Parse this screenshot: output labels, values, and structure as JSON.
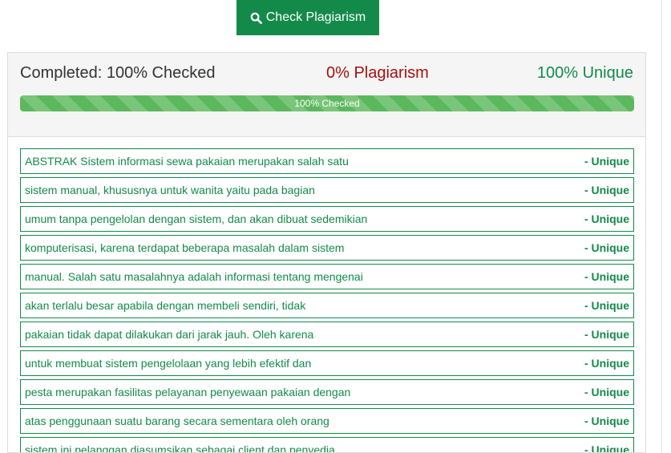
{
  "toolbar": {
    "check_label": "Check Plagiarism",
    "check_icon": "search-icon",
    "button_color": "#138a4a"
  },
  "summary": {
    "completed": "Completed: 100% Checked",
    "plagiarism": "0% Plagiarism",
    "unique": "100% Unique",
    "plagiarism_color": "#a80f0f",
    "unique_color": "#138a4a"
  },
  "progress": {
    "label": "100% Checked",
    "value": 100,
    "color": "#5cb85c"
  },
  "sentences": [
    {
      "text": "ABSTRAK Sistem informasi sewa pakaian merupakan salah satu",
      "status": "- Unique"
    },
    {
      "text": "sistem manual, khususnya untuk wanita yaitu pada bagian",
      "status": "- Unique"
    },
    {
      "text": "umum tanpa pengelolan dengan sistem, dan akan dibuat sedemikian",
      "status": "- Unique"
    },
    {
      "text": "komputerisasi, karena terdapat beberapa masalah dalam sistem",
      "status": "- Unique"
    },
    {
      "text": "manual. Salah satu masalahnya adalah informasi tentang mengenai",
      "status": "- Unique"
    },
    {
      "text": "akan terlalu besar apabila dengan membeli sendiri, tidak",
      "status": "- Unique"
    },
    {
      "text": "pakaian tidak dapat dilakukan dari jarak jauh. Oleh karena",
      "status": "- Unique"
    },
    {
      "text": "untuk membuat sistem pengelolaan yang lebih efektif dan",
      "status": "- Unique"
    },
    {
      "text": "pesta merupakan fasilitas pelayanan penyewaan pakaian dengan",
      "status": "- Unique"
    },
    {
      "text": "atas penggunaan suatu barang secara sementara oleh orang",
      "status": "- Unique"
    },
    {
      "text": "sistem ini pelanggan diasumsikan sebagai client dan penyedia",
      "status": "- Unique"
    }
  ]
}
